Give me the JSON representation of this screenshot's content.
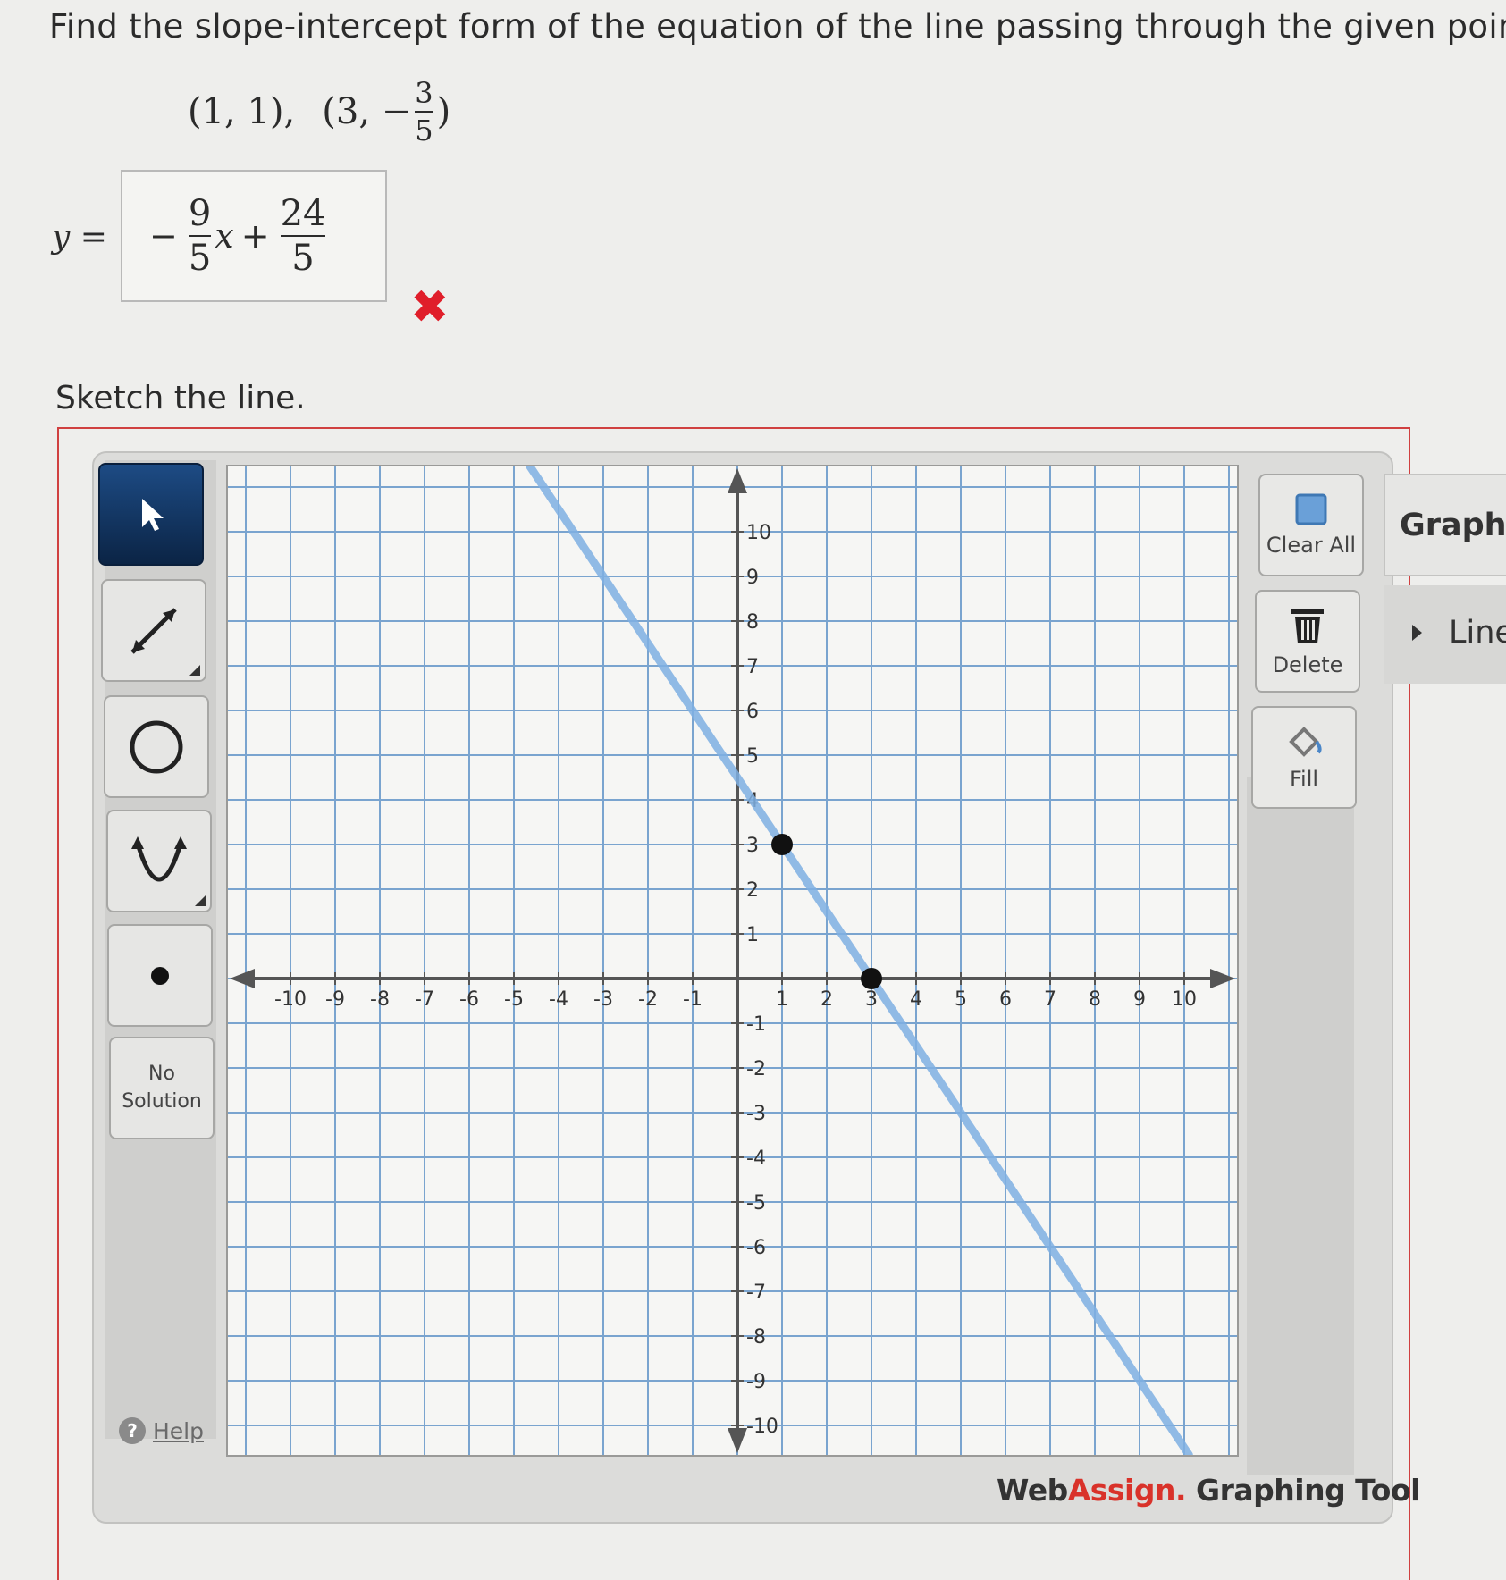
{
  "question": {
    "text": "Find the slope-intercept form of the equation of the line passing through the given points.",
    "point1": "(1, 1),",
    "point2_open": "(3, −",
    "point2_num": "3",
    "point2_den": "5",
    "point2_close": ")"
  },
  "answer": {
    "lhs": "y =",
    "minus": "−",
    "slope_num": "9",
    "slope_den": "5",
    "x": "x",
    "plus": "+",
    "int_num": "24",
    "int_den": "5",
    "status": "incorrect",
    "status_mark": "✖"
  },
  "sketch_label": "Sketch the line.",
  "tools": {
    "select": "pointer-icon",
    "line": "line-tool-icon",
    "circle": "circle-tool-icon",
    "parabola": "parabola-tool-icon",
    "point": "point-tool-icon",
    "no_solution": [
      "No",
      "Solution"
    ],
    "help": "Help",
    "help_icon": "?"
  },
  "actions": {
    "clear_all": "Clear All",
    "delete": "Delete",
    "fill": "Fill"
  },
  "side_panel": {
    "title": "Graph",
    "item": "Line"
  },
  "brand": {
    "web": "Web",
    "assign": "Assign.",
    "suffix": " Graphing Tool"
  },
  "colors": {
    "line": "#7fb0e3",
    "point": "#111111",
    "error": "#e01e2a",
    "tool_active": "#133563"
  },
  "graph": {
    "x_range": [
      -10,
      10
    ],
    "y_range": [
      -10,
      10
    ],
    "grid": true,
    "points": [
      [
        1,
        3
      ],
      [
        3,
        0
      ]
    ],
    "line": {
      "slope": -1.5,
      "intercept": 4.5
    }
  }
}
